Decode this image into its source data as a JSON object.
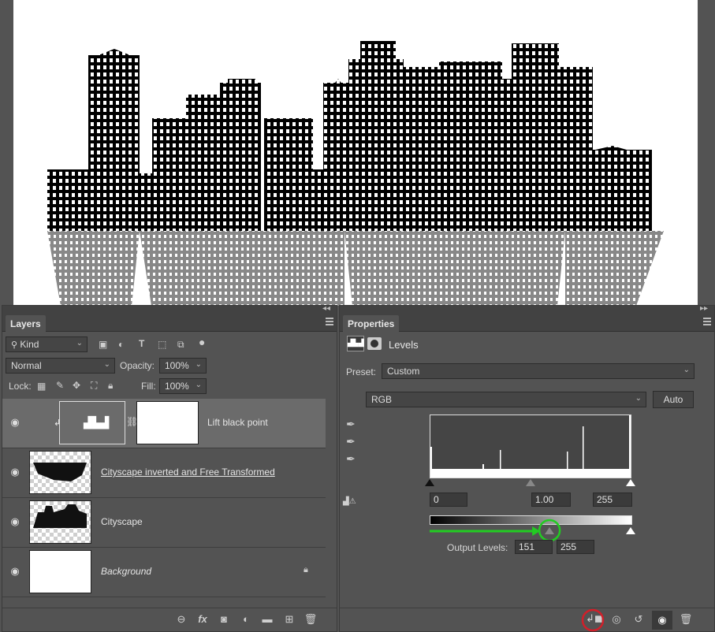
{
  "layers_panel": {
    "tab": "Layers",
    "filter_kind": "Kind",
    "blend_mode": "Normal",
    "opacity_label": "Opacity:",
    "opacity_value": "100%",
    "lock_label": "Lock:",
    "fill_label": "Fill:",
    "fill_value": "100%",
    "layers": [
      {
        "name": "Lift black point",
        "type": "adjustment"
      },
      {
        "name": "Cityscape inverted and Free Transformed",
        "type": "pixel"
      },
      {
        "name": "Cityscape",
        "type": "pixel"
      },
      {
        "name": "Background",
        "type": "background"
      }
    ],
    "bottom_icons": [
      "link-icon",
      "fx-icon",
      "mask-icon",
      "adjustment-icon",
      "folder-icon",
      "new-layer-icon",
      "trash-icon"
    ],
    "fx_label": "fx"
  },
  "properties_panel": {
    "tab": "Properties",
    "title": "Levels",
    "preset_label": "Preset:",
    "preset_value": "Custom",
    "channel": "RGB",
    "auto_label": "Auto",
    "input_black": "0",
    "input_gamma": "1.00",
    "input_white": "255",
    "output_label": "Output Levels:",
    "output_black": "151",
    "output_white": "255",
    "output_black_fraction": 0.592,
    "accent_green": "#22cc22",
    "highlight_red": "#d0202a"
  }
}
